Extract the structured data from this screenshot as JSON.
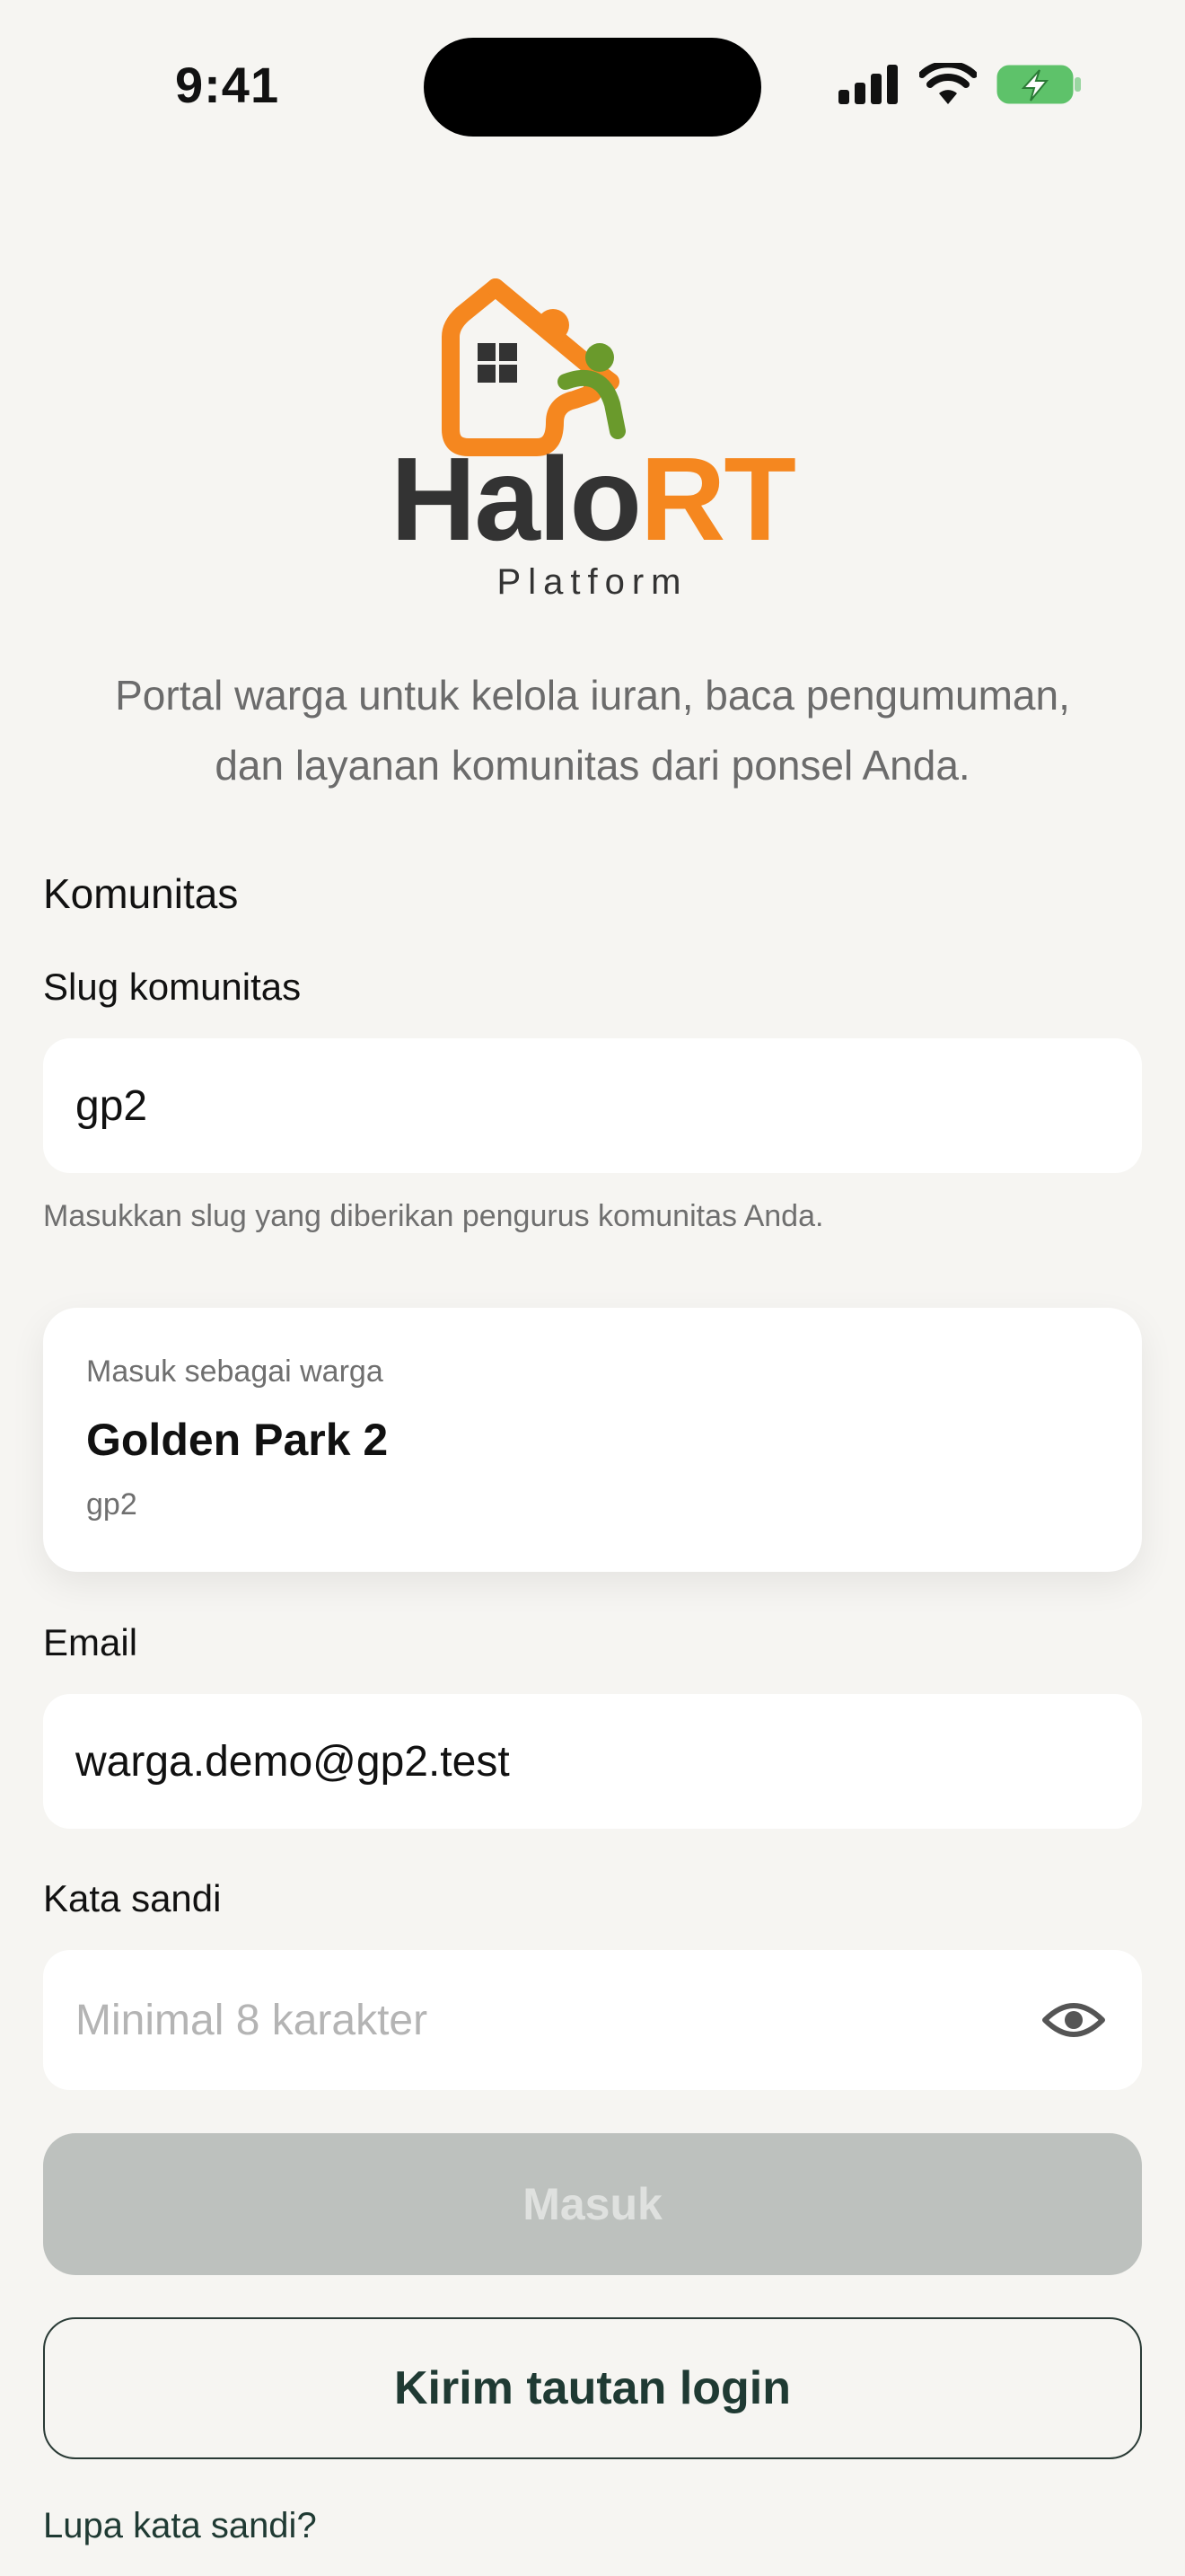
{
  "status_bar": {
    "time": "9:41"
  },
  "brand": {
    "name_part1": "Halo",
    "name_part2": "RT",
    "subtitle": "Platform"
  },
  "tagline": {
    "line1": "Portal warga untuk kelola iuran, baca pengumuman,",
    "line2": "dan layanan komunitas dari ponsel Anda."
  },
  "community": {
    "section_title": "Komunitas",
    "slug_label": "Slug komunitas",
    "slug_value": "gp2",
    "helper": "Masukkan slug yang diberikan pengurus komunitas Anda."
  },
  "community_card": {
    "label": "Masuk sebagai warga",
    "name": "Golden Park 2",
    "slug": "gp2"
  },
  "email": {
    "label": "Email",
    "value": "warga.demo@gp2.test"
  },
  "password": {
    "label": "Kata sandi",
    "placeholder": "Minimal 8 karakter"
  },
  "actions": {
    "login_label": "Masuk",
    "magic_link_label": "Kirim tautan login",
    "forgot_label": "Lupa kata sandi?"
  },
  "colors": {
    "accent": "#f5871f",
    "green": "#6a9a2c",
    "dark": "#333333",
    "button_disabled": "#bdc1be",
    "outline": "#1f3a33"
  },
  "icons": [
    "signal-icon",
    "wifi-icon",
    "battery-charging-icon",
    "eye-icon"
  ]
}
